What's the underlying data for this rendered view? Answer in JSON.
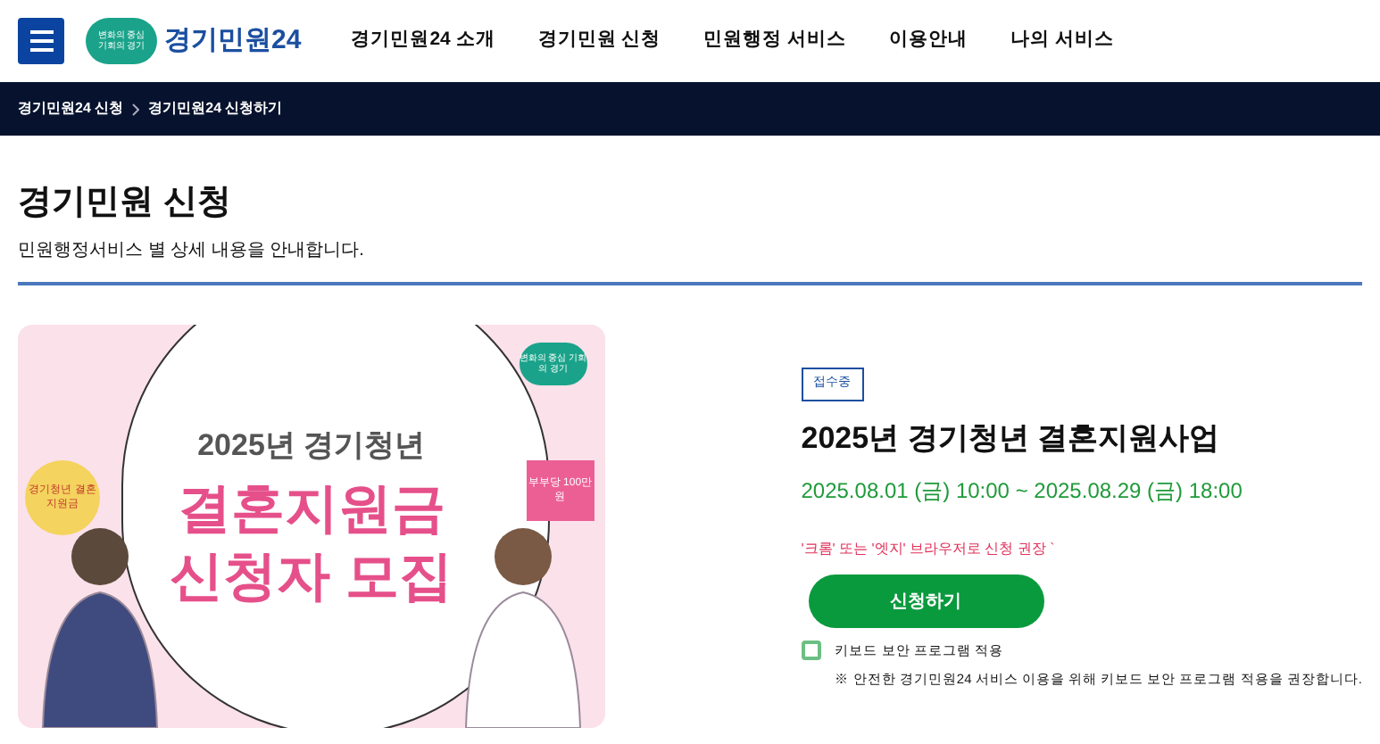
{
  "header": {
    "logo_badge": "변화의 중심 기회의 경기",
    "logo_text": "경기민원24",
    "nav": [
      {
        "label": "경기민원24 소개"
      },
      {
        "label": "경기민원 신청"
      },
      {
        "label": "민원행정 서비스"
      },
      {
        "label": "이용안내"
      },
      {
        "label": "나의 서비스"
      }
    ]
  },
  "breadcrumb": [
    "경기민원24 신청",
    "경기민원24 신청하기"
  ],
  "page": {
    "title": "경기민원 신청",
    "subtitle": "민원행정서비스 별 상세 내용을 안내합니다."
  },
  "banner": {
    "badge": "변화의 중심 기회의 경기",
    "line1": "2025년 경기청년",
    "line2": "결혼지원금",
    "line3": "신청자 모집",
    "sign_left": "경기청년 결혼지원금",
    "sign_right": "부부당 100만원"
  },
  "detail": {
    "status": "접수중",
    "title": "2025년 경기청년 결혼지원사업",
    "period": "2025.08.01 (금) 10:00 ~ 2025.08.29 (금) 18:00",
    "notice": "'크롬' 또는 '엣지' 브라우저로 신청 권장 `",
    "apply_button": "신청하기",
    "keyboard_security": {
      "label": "키보드 보안 프로그램 적용",
      "checked": false
    },
    "security_note": "※ 안전한 경기민원24 서비스 이용을 위해 키보드 보안 프로그램 적용을 권장합니다."
  }
}
